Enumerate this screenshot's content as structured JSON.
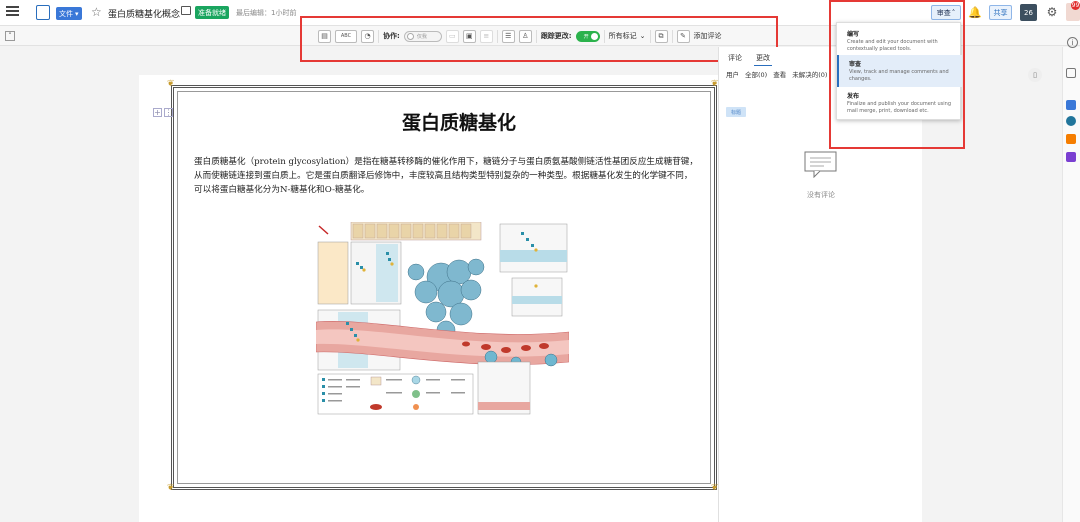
{
  "header": {
    "file_label": "文件",
    "doc_title": "蛋白质糖基化概念",
    "status_badge": "准备就绪",
    "last_edit": "最后编辑：1小时前",
    "mode_label": "审查",
    "share_label": "共享",
    "user_initials": "26",
    "notification_count": "99"
  },
  "review_toolbar": {
    "collab_label": "协作:",
    "collab_toggle_text": "仅我",
    "track_changes_label": "跟踪更改:",
    "track_toggle_text": "开",
    "markup_option": "所有标记",
    "add_comment_label": "添加评论",
    "spellcheck_label": "ABC"
  },
  "document": {
    "heading": "蛋白质糖基化",
    "paragraph": "蛋白质糖基化（protein  glycosylation）是指在糖基转移酶的催化作用下，糖链分子与蛋白质氨基酸侧链活性基团反应生成糖苷键，从而使糖链连接到蛋白质上。它是蛋白质翻译后修饰中，丰度较高且结构类型特别复杂的一种类型。根据糖基化发生的化学键不同，可以将蛋白糖基化分为N-糖基化和O-糖基化。"
  },
  "sidebar": {
    "tabs": [
      "评论",
      "更改"
    ],
    "filter_user_label": "用户",
    "filter_user_value": "全部(0)",
    "filter_view_label": "查看",
    "filter_view_value": "未解决的(0)",
    "tag_label": "标题",
    "empty_text": "没有评论"
  },
  "mode_menu": {
    "items": [
      {
        "title": "编写",
        "desc": "Create and edit your document with contextually placed tools."
      },
      {
        "title": "审查",
        "desc": "View, track and manage comments and changes."
      },
      {
        "title": "发布",
        "desc": "Finalize and publish your document using mail merge, print, download etc."
      }
    ]
  },
  "colors": {
    "accent": "#2a6ebd",
    "ready_green": "#1aa55f",
    "highlight_red": "#e53935"
  }
}
